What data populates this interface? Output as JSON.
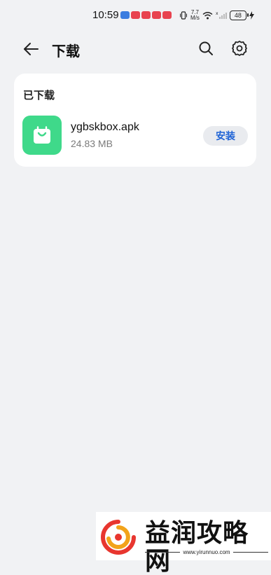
{
  "status_bar": {
    "time": "10:59",
    "net_speed_value": "7.7",
    "net_speed_unit": "M/s",
    "battery": "48",
    "notification_colors": [
      "#3b7de0",
      "#e8434f",
      "#e8434f",
      "#e8434f",
      "#e8434f"
    ]
  },
  "header": {
    "title": "下载",
    "back_icon": "arrow-left-icon",
    "search_icon": "search-icon",
    "settings_icon": "gear-icon"
  },
  "downloads": {
    "section_title": "已下载",
    "items": [
      {
        "file_name": "ygbskbox.apk",
        "file_size": "24.83 MB",
        "action_label": "安装",
        "icon": "shopping-bag-icon",
        "icon_color": "#3fd98a"
      }
    ]
  },
  "watermark": {
    "brand": "益润攻略网",
    "url": "www.yirunnuo.com"
  },
  "colors": {
    "background": "#f1f2f4",
    "card": "#ffffff",
    "accent_blue": "#1f63d6"
  }
}
